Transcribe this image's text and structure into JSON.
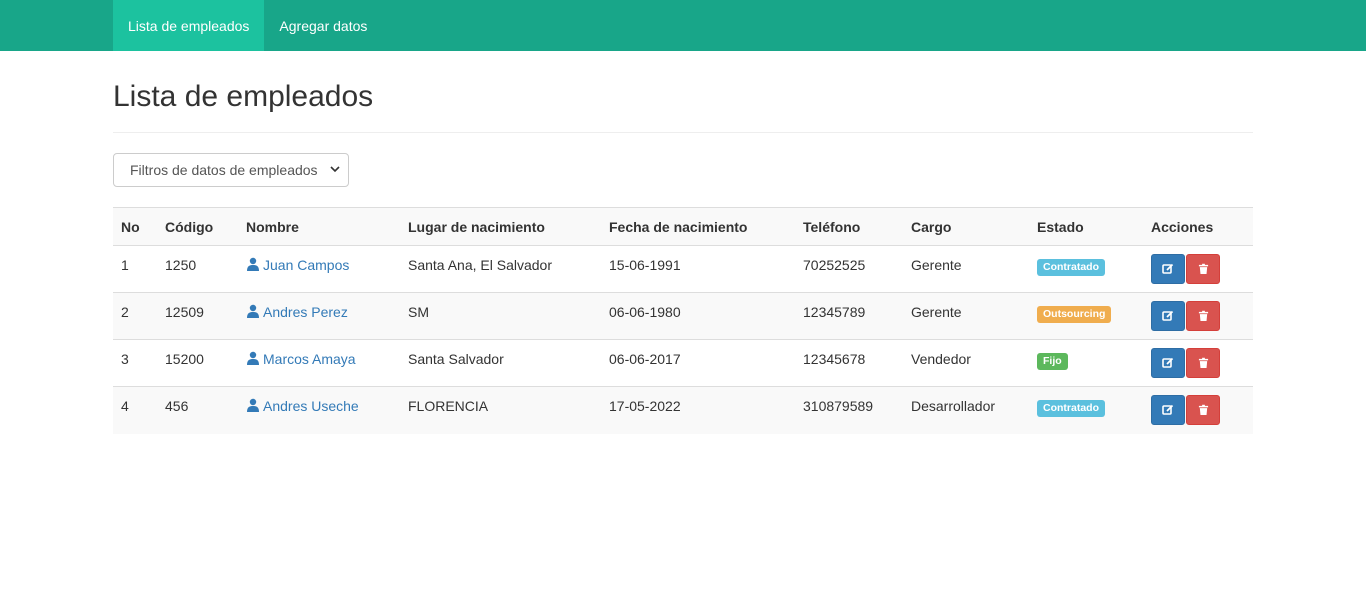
{
  "nav": {
    "items": [
      {
        "label": "Lista de empleados",
        "active": true
      },
      {
        "label": "Agregar datos",
        "active": false
      }
    ]
  },
  "page": {
    "title": "Lista de empleados",
    "filter_label": "Filtros de datos de empleados"
  },
  "table": {
    "headers": [
      "No",
      "Código",
      "Nombre",
      "Lugar de nacimiento",
      "Fecha de nacimiento",
      "Teléfono",
      "Cargo",
      "Estado",
      "Acciones"
    ],
    "rows": [
      {
        "no": "1",
        "codigo": "1250",
        "nombre": "Juan Campos",
        "lugar": "Santa Ana, El Salvador",
        "fecha": "15-06-1991",
        "telefono": "70252525",
        "cargo": "Gerente",
        "estado": "Contratado",
        "estado_color": "#5bc0de"
      },
      {
        "no": "2",
        "codigo": "12509",
        "nombre": "Andres Perez",
        "lugar": "SM",
        "fecha": "06-06-1980",
        "telefono": "12345789",
        "cargo": "Gerente",
        "estado": "Outsourcing",
        "estado_color": "#f0ad4e"
      },
      {
        "no": "3",
        "codigo": "15200",
        "nombre": "Marcos Amaya",
        "lugar": "Santa Salvador",
        "fecha": "06-06-2017",
        "telefono": "12345678",
        "cargo": "Vendedor",
        "estado": "Fijo",
        "estado_color": "#5cb85c"
      },
      {
        "no": "4",
        "codigo": "456",
        "nombre": "Andres Useche",
        "lugar": "FLORENCIA",
        "fecha": "17-05-2022",
        "telefono": "310879589",
        "cargo": "Desarrollador",
        "estado": "Contratado",
        "estado_color": "#5bc0de"
      }
    ]
  },
  "icons": {
    "user": "user-icon",
    "edit": "edit-icon",
    "delete": "trash-icon",
    "dropdown": "chevron-down-icon"
  },
  "colors": {
    "navbar": "#18a689",
    "navbar_active": "#1cc29f",
    "link": "#337ab7",
    "edit_button": "#337ab7",
    "delete_button": "#d9534f"
  }
}
